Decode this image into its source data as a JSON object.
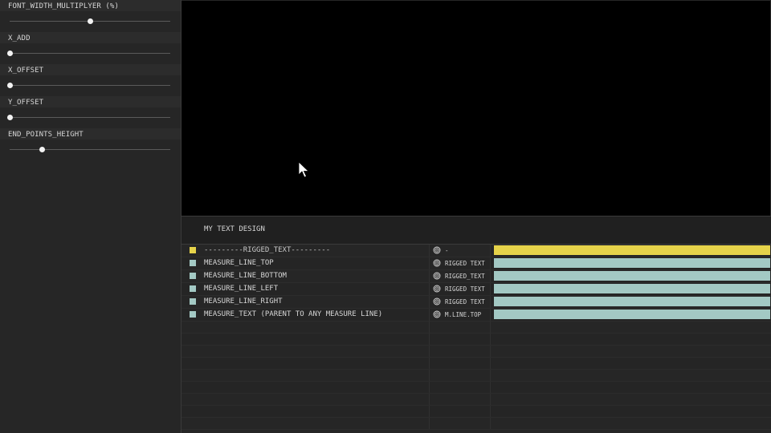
{
  "params": [
    {
      "label": "FONT_WIDTH_MULTIPLYER (%)",
      "value": 0.5
    },
    {
      "label": "X_ADD",
      "value": 0.0
    },
    {
      "label": "X_OFFSET",
      "value": 0.0
    },
    {
      "label": "Y_OFFSET",
      "value": 0.0
    },
    {
      "label": "END_POINTS_HEIGHT",
      "value": 0.2
    }
  ],
  "composition": {
    "title": "MY TEXT DESIGN"
  },
  "layers": [
    {
      "name": "---------RIGGED_TEXT---------",
      "parent": "-",
      "color": "#e6d34a",
      "dashed": true
    },
    {
      "name": "MEASURE_LINE_TOP",
      "parent": "RIGGED TEXT",
      "color": "#a3c9c4"
    },
    {
      "name": "MEASURE_LINE_BOTTOM",
      "parent": "RIGGED_TEXT",
      "color": "#a3c9c4"
    },
    {
      "name": "MEASURE_LINE_LEFT",
      "parent": "RIGGED TEXT",
      "color": "#a3c9c4"
    },
    {
      "name": "MEASURE_LINE_RIGHT",
      "parent": "RIGGED TEXT",
      "color": "#a3c9c4"
    },
    {
      "name": "MEASURE_TEXT (PARENT TO ANY MEASURE LINE)",
      "parent": "M.LINE.TOP",
      "color": "#a3c9c4"
    }
  ],
  "icons": {
    "pickwhip": "spiral-icon",
    "cursor": "mouse-pointer-icon"
  }
}
